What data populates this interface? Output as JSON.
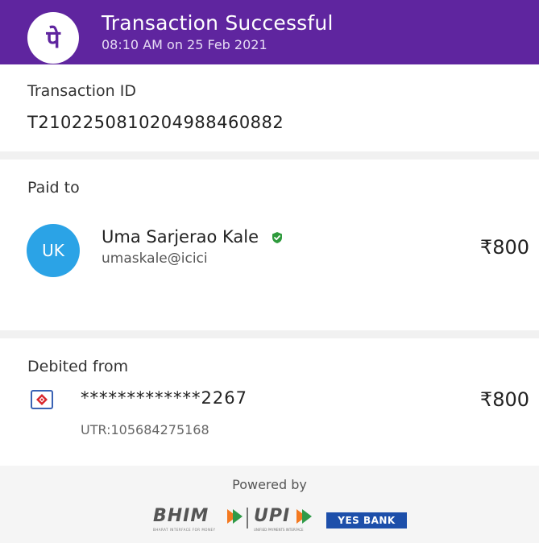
{
  "header": {
    "title": "Transaction Successful",
    "datetime": "08:10 AM on 25 Feb 2021",
    "logo_glyph": "पे"
  },
  "transaction": {
    "label": "Transaction ID",
    "id": "T2102250810204988460882"
  },
  "paid_to": {
    "label": "Paid to",
    "avatar_initials": "UK",
    "name": "Uma Sarjerao Kale",
    "upi_id": "umaskale@icici",
    "amount": "₹800"
  },
  "debited_from": {
    "label": "Debited from",
    "account": "*************2267",
    "utr": "UTR:105684275168",
    "amount": "₹800"
  },
  "footer": {
    "powered_by": "Powered by",
    "bhim": "BHIM",
    "bhim_tagline": "BHARAT INTERFACE FOR MONEY",
    "upi": "UPI",
    "upi_tagline": "UNIFIED PAYMENTS INTERFACE",
    "bank": "YES BANK"
  },
  "colors": {
    "brand_purple": "#5f259f",
    "avatar_blue": "#2ba3e6",
    "verified_green": "#2e9a3c",
    "bank_blue": "#1d4faa"
  }
}
